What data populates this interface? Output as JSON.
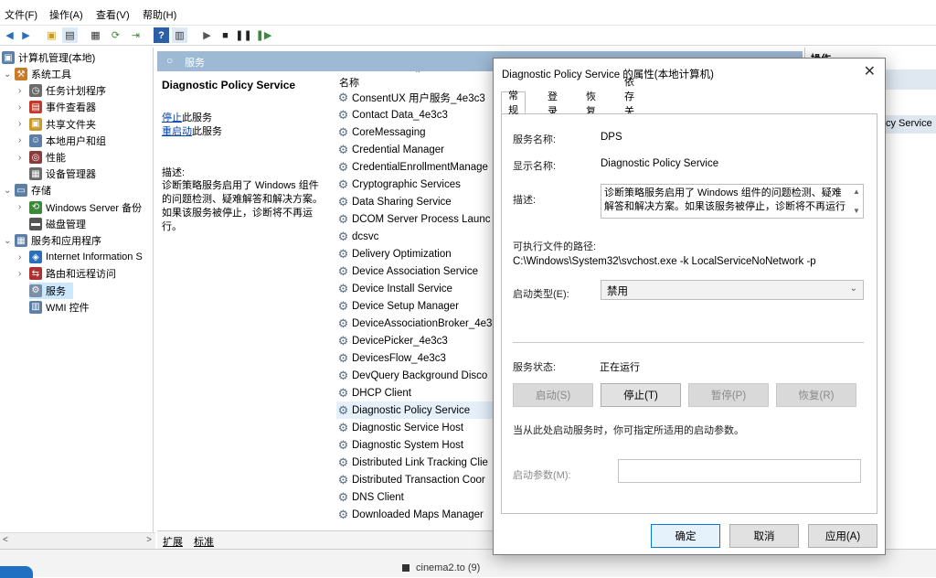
{
  "menu": [
    "文件(F)",
    "操作(A)",
    "查看(V)",
    "帮助(H)"
  ],
  "tree": {
    "root": "计算机管理(本地)",
    "items": [
      {
        "label": "系统工具",
        "level": 1,
        "expanded": true
      },
      {
        "label": "任务计划程序",
        "level": 2
      },
      {
        "label": "事件查看器",
        "level": 2
      },
      {
        "label": "共享文件夹",
        "level": 2
      },
      {
        "label": "本地用户和组",
        "level": 2
      },
      {
        "label": "性能",
        "level": 2
      },
      {
        "label": "设备管理器",
        "level": 2
      },
      {
        "label": "存储",
        "level": 1,
        "expanded": true
      },
      {
        "label": "Windows Server 备份",
        "level": 2
      },
      {
        "label": "磁盘管理",
        "level": 2
      },
      {
        "label": "服务和应用程序",
        "level": 1,
        "expanded": true
      },
      {
        "label": "Internet Information S",
        "level": 2
      },
      {
        "label": "路由和远程访问",
        "level": 2
      },
      {
        "label": "服务",
        "level": 2,
        "selected": true
      },
      {
        "label": "WMI 控件",
        "level": 2
      }
    ]
  },
  "services_header": "服务",
  "selected_service": {
    "name": "Diagnostic Policy Service",
    "stop_link": "停止",
    "stop_suffix": "此服务",
    "restart_link": "重启动",
    "restart_suffix": "此服务",
    "desc_label": "描述:",
    "desc_text": "诊断策略服务启用了 Windows 组件的问题检测、疑难解答和解决方案。如果该服务被停止，诊断将不再运行。"
  },
  "list": {
    "column": "名称",
    "items": [
      "ConsentUX 用户服务_4e3c3",
      "Contact Data_4e3c3",
      "CoreMessaging",
      "Credential Manager",
      "CredentialEnrollmentManage",
      "Cryptographic Services",
      "Data Sharing Service",
      "DCOM Server Process Launc",
      "dcsvc",
      "Delivery Optimization",
      "Device Association Service",
      "Device Install Service",
      "Device Setup Manager",
      "DeviceAssociationBroker_4e3",
      "DevicePicker_4e3c3",
      "DevicesFlow_4e3c3",
      "DevQuery Background Disco",
      "DHCP Client",
      "Diagnostic Policy Service",
      "Diagnostic Service Host",
      "Diagnostic System Host",
      "Distributed Link Tracking Clie",
      "Distributed Transaction Coor",
      "DNS Client",
      "Downloaded Maps Manager"
    ],
    "selected_index": 18
  },
  "bottom_tabs": [
    "扩展",
    "标准"
  ],
  "right_pane": {
    "header": "操作",
    "item": "cy Service"
  },
  "taskbar_text": "cinema2.to (9)",
  "dialog": {
    "title": "Diagnostic Policy Service 的属性(本地计算机)",
    "tabs": [
      "常规",
      "登录",
      "恢复",
      "依存关系"
    ],
    "service_name_label": "服务名称:",
    "service_name": "DPS",
    "display_name_label": "显示名称:",
    "display_name": "Diagnostic Policy Service",
    "description_label": "描述:",
    "description": "诊断策略服务启用了 Windows 组件的问题检测、疑难解答和解决方案。如果该服务被停止，诊断将不再运行",
    "path_label": "可执行文件的路径:",
    "path": "C:\\Windows\\System32\\svchost.exe -k LocalServiceNoNetwork -p",
    "startup_type_label": "启动类型(E):",
    "startup_type": "禁用",
    "status_label": "服务状态:",
    "status": "正在运行",
    "buttons": {
      "start": "启动(S)",
      "stop": "停止(T)",
      "pause": "暂停(P)",
      "resume": "恢复(R)"
    },
    "hint": "当从此处启动服务时，你可指定所适用的启动参数。",
    "params_label": "启动参数(M):",
    "ok": "确定",
    "cancel": "取消",
    "apply": "应用(A)"
  }
}
